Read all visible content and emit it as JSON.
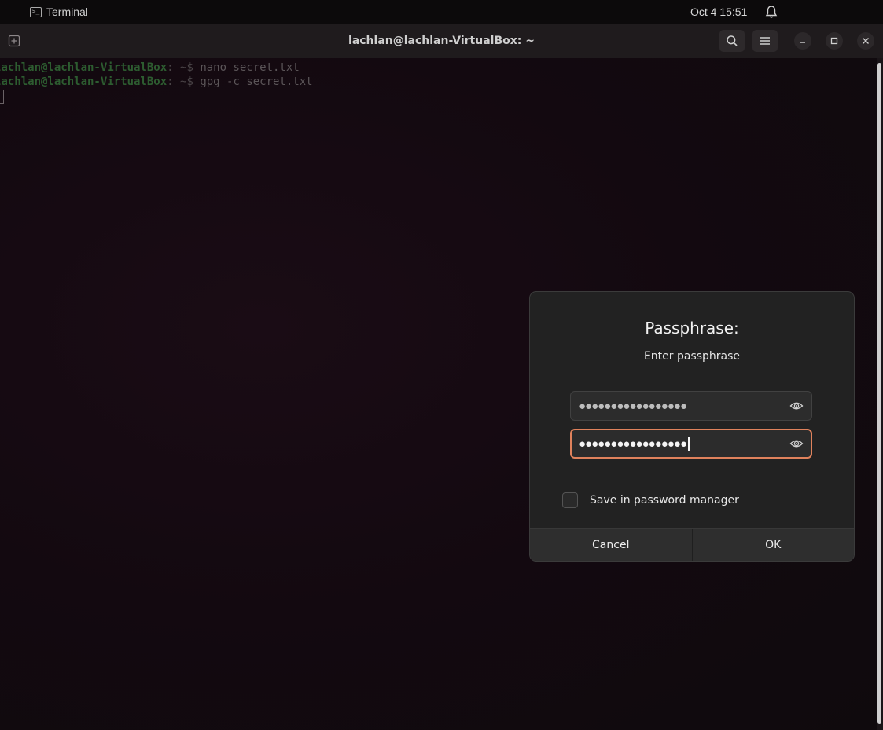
{
  "topbar": {
    "app_name": "Terminal",
    "clock": "Oct 4  15:51",
    "icons": [
      "terminal-app-icon",
      "notification-bell-icon"
    ]
  },
  "window": {
    "title": "lachlan@lachlan-VirtualBox: ~",
    "icons": [
      "new-tab-icon",
      "search-icon",
      "menu-icon",
      "minimize-icon",
      "maximize-icon",
      "close-icon"
    ]
  },
  "terminal": {
    "lines": [
      {
        "user": "lachlan@lachlan-VirtualBox",
        "path": ": ~$ ",
        "command": "nano secret.txt"
      },
      {
        "user": "lachlan@lachlan-VirtualBox",
        "path": ": ~$ ",
        "command": "gpg -c secret.txt"
      }
    ]
  },
  "dialog": {
    "title": "Passphrase:",
    "subtitle": "Enter passphrase",
    "passphrase_dots": "●●●●●●●●●●●●●●●●●",
    "repeat_dots": "●●●●●●●●●●●●●●●●●",
    "save_label": "Save in password manager",
    "cancel_label": "Cancel",
    "ok_label": "OK"
  },
  "colors": {
    "focus_accent": "#e0825c",
    "prompt_user": "#2d5c30"
  }
}
